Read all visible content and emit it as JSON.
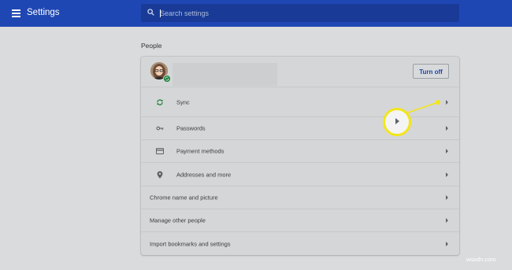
{
  "app": {
    "title": "Settings"
  },
  "search": {
    "placeholder": "Search settings"
  },
  "section": {
    "title": "People"
  },
  "profile": {
    "turn_off_label": "Turn off"
  },
  "rows": [
    {
      "label": "Sync",
      "icon": "sync-icon"
    },
    {
      "label": "Passwords",
      "icon": "key-icon"
    },
    {
      "label": "Payment methods",
      "icon": "credit-card-icon"
    },
    {
      "label": "Addresses and more",
      "icon": "location-pin-icon"
    },
    {
      "label": "Chrome name and picture"
    },
    {
      "label": "Manage other people"
    },
    {
      "label": "Import bookmarks and settings"
    }
  ],
  "callout": {
    "color": "#f2e619"
  },
  "colors": {
    "topbar": "#1f47b4",
    "search": "#193b97",
    "accent": "#1a47b0",
    "background": "#dadbdc"
  },
  "watermark": {
    "text": "wsxdn.com"
  }
}
